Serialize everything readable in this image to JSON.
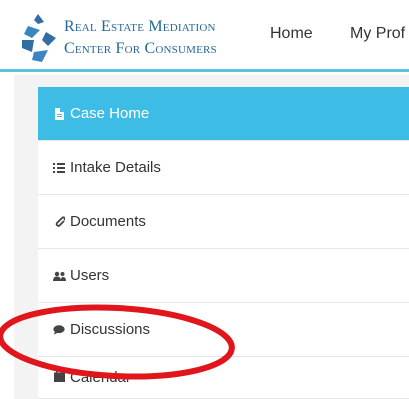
{
  "brand": {
    "line1": "Real Estate Mediation",
    "line2": "Center For Consumers"
  },
  "nav": {
    "home": "Home",
    "profile": "My Prof"
  },
  "sidebar": {
    "items": [
      {
        "label": "Case Home",
        "icon": "file-icon",
        "active": true
      },
      {
        "label": "Intake Details",
        "icon": "list-icon",
        "active": false
      },
      {
        "label": "Documents",
        "icon": "paperclip-icon",
        "active": false
      },
      {
        "label": "Users",
        "icon": "users-icon",
        "active": false
      },
      {
        "label": "Discussions",
        "icon": "chat-bubble-icon",
        "active": false
      },
      {
        "label": "Calendar",
        "icon": "calendar-icon",
        "active": false
      }
    ]
  },
  "colors": {
    "accent": "#3dbde6",
    "brand": "#24689a",
    "annotation": "#e0161c"
  }
}
